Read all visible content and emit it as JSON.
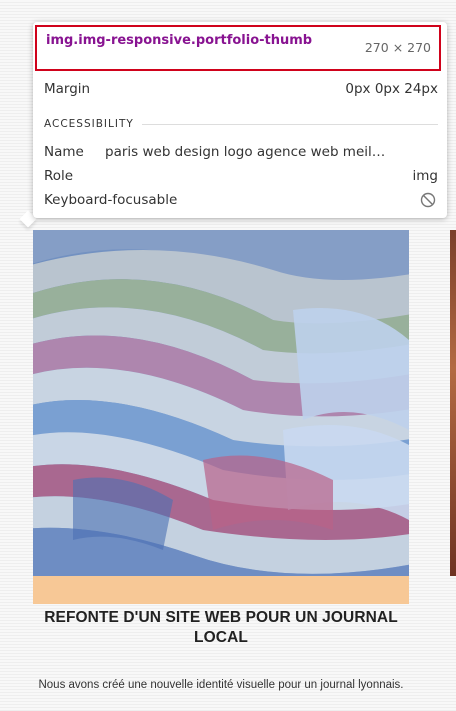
{
  "inspector": {
    "selector": "img.img-responsive.portfolio-thumb",
    "dimensions": "270 × 270",
    "margin_label": "Margin",
    "margin_value": "0px 0px 24px",
    "section_title": "ACCESSIBILITY",
    "name_label": "Name",
    "name_value": "paris web design logo agence web meil…",
    "role_label": "Role",
    "role_value": "img",
    "focusable_label": "Keyboard-focusable",
    "focusable_icon": "not-allowed-icon"
  },
  "card": {
    "title": "REFONTE D'UN SITE WEB POUR UN JOURNAL LOCAL",
    "description": "Nous avons créé une nouvelle identité visuelle pour un journal lyonnais.",
    "image_icon": "magazines-photo"
  },
  "colors": {
    "selector": "#881391",
    "header_border": "#d0021b",
    "element_highlight": "#6fa1e8",
    "margin_highlight": "#f7c896"
  }
}
